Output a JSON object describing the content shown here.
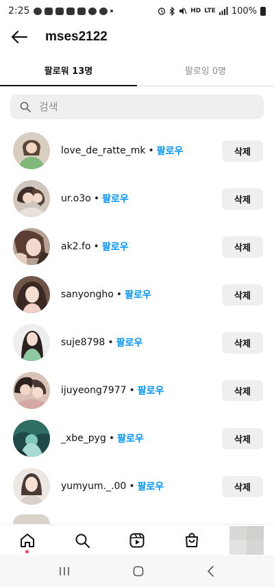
{
  "status_bar": {
    "time": "2:25",
    "battery": "100%",
    "network_label": "HD",
    "lte_label": "LTE"
  },
  "header": {
    "title": "mses2122"
  },
  "tabs": [
    {
      "label": "팔로워 13명",
      "active": true
    },
    {
      "label": "팔로잉 0명",
      "active": false
    }
  ],
  "search": {
    "placeholder": "검색"
  },
  "followers": [
    {
      "username": "love_de_ratte_mk",
      "separator": "•",
      "follow_label": "팔로우",
      "remove_label": "삭제"
    },
    {
      "username": "ur.o3o",
      "separator": "•",
      "follow_label": "팔로우",
      "remove_label": "삭제"
    },
    {
      "username": "ak2.fo",
      "separator": "•",
      "follow_label": "팔로우",
      "remove_label": "삭제"
    },
    {
      "username": "sanyongho",
      "separator": "•",
      "follow_label": "팔로우",
      "remove_label": "삭제"
    },
    {
      "username": "suje8798",
      "separator": "•",
      "follow_label": "팔로우",
      "remove_label": "삭제"
    },
    {
      "username": "ijuyeong7977",
      "separator": "•",
      "follow_label": "팔로우",
      "remove_label": "삭제"
    },
    {
      "username": "_xbe_pyg",
      "separator": "•",
      "follow_label": "팔로우",
      "remove_label": "삭제"
    },
    {
      "username": "yumyum._.00",
      "separator": "•",
      "follow_label": "팔로우",
      "remove_label": "삭제"
    }
  ],
  "colors": {
    "accent": "#0095f6",
    "notification_dot": "#ed4956",
    "button_bg": "#efefef"
  },
  "bottom_nav": [
    {
      "icon": "home-icon",
      "active": true
    },
    {
      "icon": "search-icon"
    },
    {
      "icon": "reels-icon"
    },
    {
      "icon": "shop-icon"
    },
    {
      "icon": "profile-avatar"
    }
  ],
  "system_nav": [
    {
      "icon": "recent-apps-icon"
    },
    {
      "icon": "home-button-icon"
    },
    {
      "icon": "back-icon"
    }
  ]
}
